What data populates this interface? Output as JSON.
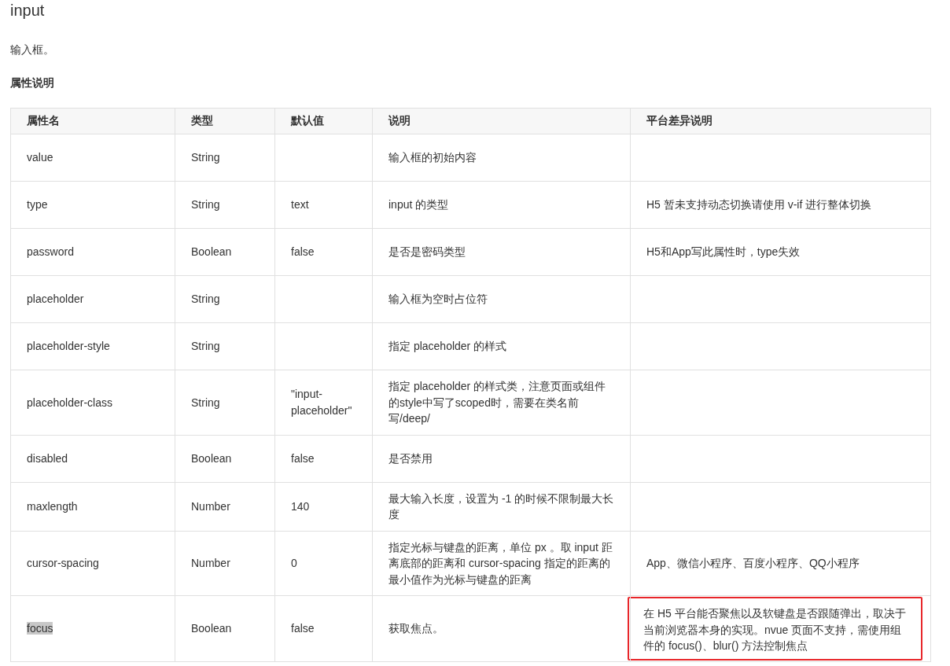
{
  "title": "input",
  "description": "输入框。",
  "section_heading": "属性说明",
  "table": {
    "columns": [
      "属性名",
      "类型",
      "默认值",
      "说明",
      "平台差异说明"
    ],
    "rows": [
      {
        "cells": [
          "value",
          "String",
          "",
          "输入框的初始内容",
          ""
        ]
      },
      {
        "cells": [
          "type",
          "String",
          "text",
          "input 的类型",
          "H5 暂未支持动态切换请使用 v-if 进行整体切换"
        ]
      },
      {
        "cells": [
          "password",
          "Boolean",
          "false",
          "是否是密码类型",
          "H5和App写此属性时，type失效"
        ]
      },
      {
        "cells": [
          "placeholder",
          "String",
          "",
          "输入框为空时占位符",
          ""
        ]
      },
      {
        "cells": [
          "placeholder-style",
          "String",
          "",
          "指定 placeholder 的样式",
          ""
        ]
      },
      {
        "cells": [
          "placeholder-class",
          "String",
          "\"input-placeholder\"",
          "指定 placeholder 的样式类，注意页面或组件的style中写了scoped时，需要在类名前写/deep/",
          ""
        ]
      },
      {
        "cells": [
          "disabled",
          "Boolean",
          "false",
          "是否禁用",
          ""
        ]
      },
      {
        "cells": [
          "maxlength",
          "Number",
          "140",
          "最大输入长度，设置为 -1 的时候不限制最大长度",
          ""
        ]
      },
      {
        "cells": [
          "cursor-spacing",
          "Number",
          "0",
          "指定光标与键盘的距离，单位 px 。取 input 距离底部的距离和 cursor-spacing 指定的距离的最小值作为光标与键盘的距离",
          "App、微信小程序、百度小程序、QQ小程序"
        ]
      },
      {
        "cells": [
          "focus",
          "Boolean",
          "false",
          "获取焦点。",
          "在 H5 平台能否聚焦以及软键盘是否跟随弹出，取决于当前浏览器本身的实现。nvue 页面不支持，需使用组件的 focus()、blur() 方法控制焦点"
        ],
        "name_highlighted": true,
        "note_outlined": true
      }
    ]
  }
}
